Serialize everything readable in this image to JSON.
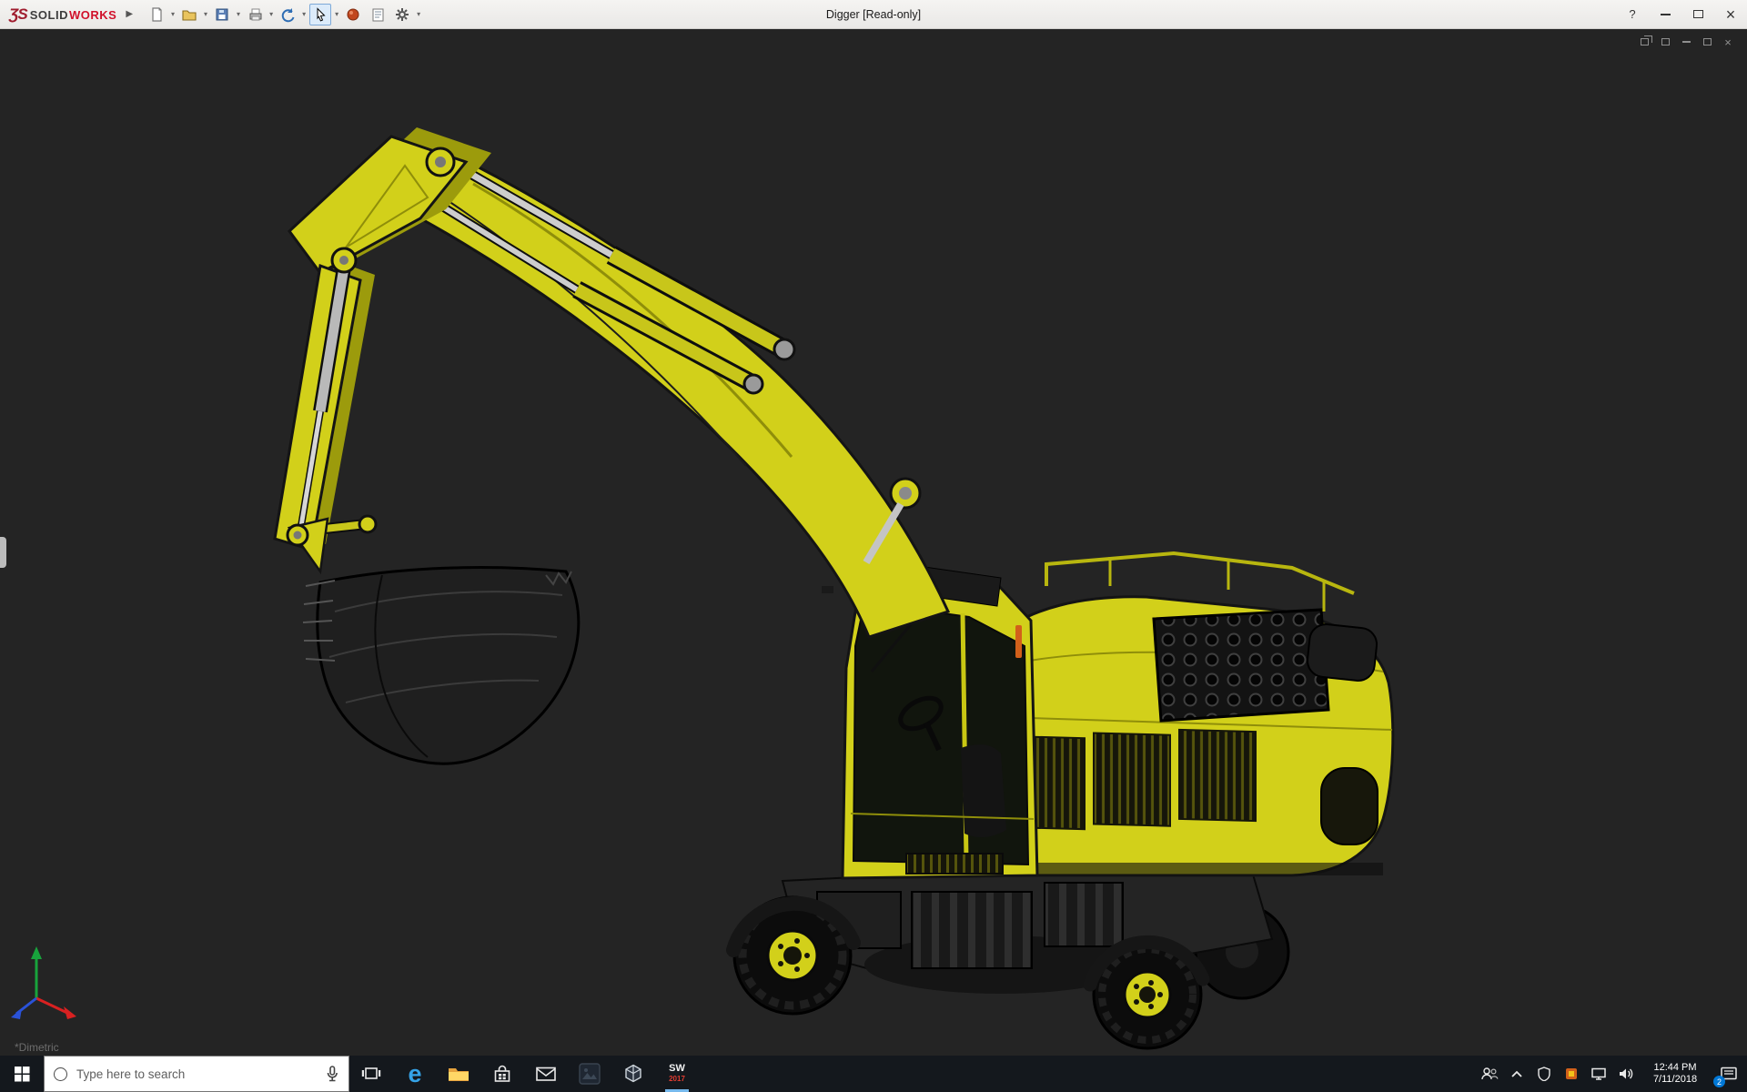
{
  "titlebar": {
    "logo_mark": "ƷS",
    "brand_solid": "SOLID",
    "brand_works": "WORKS",
    "expand_arrow": "▶",
    "dropdown_glyph": "▾",
    "title": "Digger [Read-only]",
    "help_glyph": "?",
    "close_glyph": "×"
  },
  "viewport": {
    "view_label": "*Dimetric",
    "doc_close_glyph": "×",
    "background_color": "#242424",
    "model_color": "#d2d01a",
    "model_accent": "#d2601a"
  },
  "taskbar": {
    "search_placeholder": "Type here to search",
    "solidworks_top": "SW",
    "solidworks_year": "2017",
    "clock_time": "12:44 PM",
    "clock_date": "7/11/2018",
    "notification_badge": "2"
  }
}
